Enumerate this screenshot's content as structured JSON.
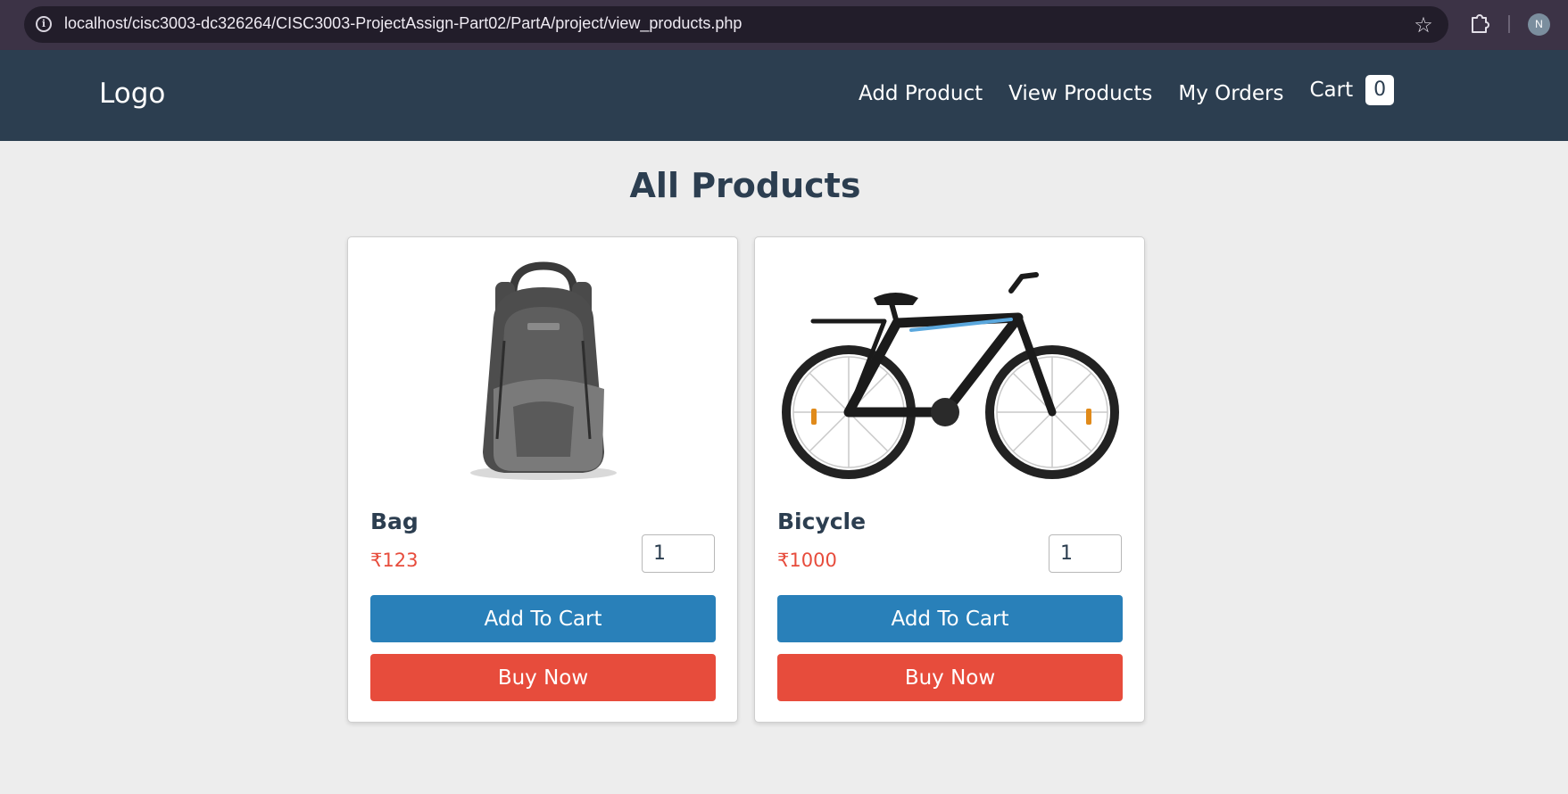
{
  "browser": {
    "url": "localhost/cisc3003-dc326264/CISC3003-ProjectAssign-Part02/PartA/project/view_products.php",
    "profile_initial": "N"
  },
  "navbar": {
    "logo": "Logo",
    "links": [
      "Add Product",
      "View Products",
      "My Orders"
    ],
    "cart_label": "Cart",
    "cart_count": "0"
  },
  "main": {
    "title": "All Products",
    "products": [
      {
        "name": "Bag",
        "price": "₹123",
        "qty": "1",
        "add_label": "Add To Cart",
        "buy_label": "Buy Now"
      },
      {
        "name": "Bicycle",
        "price": "₹1000",
        "qty": "1",
        "add_label": "Add To Cart",
        "buy_label": "Buy Now"
      }
    ]
  },
  "colors": {
    "navbar": "#2c3e50",
    "add_to_cart": "#2980b9",
    "buy_now": "#e74c3c",
    "price": "#e74c3c"
  }
}
